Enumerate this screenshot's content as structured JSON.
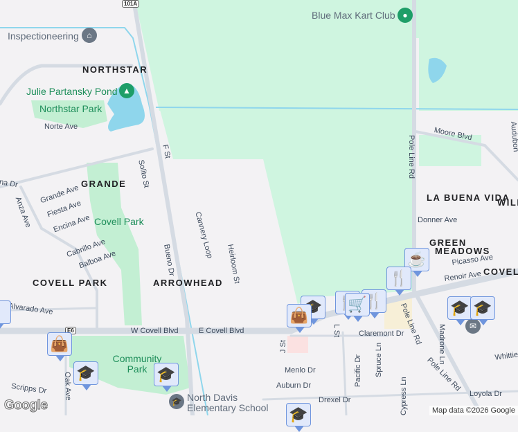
{
  "map": {
    "colors": {
      "field": "#cff5e0",
      "park": "#c3efd3",
      "water": "#8fd6ec",
      "road": "#d5dbe3",
      "bg": "#f3f2f4",
      "marker_bg": "#e1e9fb",
      "marker_border": "#6f95dd",
      "marker_icon": "#0d4a6b"
    },
    "neighborhoods": [
      "NORTHSTAR",
      "GRANDE",
      "COVELL PARK",
      "ARROWHEAD",
      "LA BUENA VIDA",
      "GREEN",
      "MEADOWS",
      "COVELL",
      "WILD"
    ],
    "parks": [
      "Julie Partansky Pond",
      "Northstar Park",
      "Covell Park",
      "Community Park"
    ],
    "pois": [
      "Inspectioneering",
      "Blue Max Kart Club",
      "North Davis Elementary School"
    ],
    "streets": [
      "Norte Ave",
      "Grande Ave",
      "Fiesta Ave",
      "Encina Ave",
      "Cabrillo Ave",
      "Balboa Ave",
      "Anza Ave",
      "Solito St",
      "F St",
      "Cannery Loop",
      "Heirloom St",
      "Bueno Dr",
      "Alvarado Ave",
      "W Covell Blvd",
      "E Covell Blvd",
      "Oak Ave",
      "Scripps Dr",
      "J St",
      "L St",
      "Claremont Dr",
      "Menlo Dr",
      "Auburn Dr",
      "Drexel Dr",
      "Pacific Dr",
      "Spruce Ln",
      "Cypress Ln",
      "Pole Line Rd",
      "Pole Line Rd",
      "Madrone Ln",
      "Loyola Dr",
      "Whittier",
      "Moore Blvd",
      "Donner Ave",
      "Picasso Ave",
      "Renoir Ave",
      "na Dr",
      "Audubon"
    ],
    "shields": [
      "101A",
      "E6"
    ],
    "attribution": "Map data ©2026 Google",
    "logo": "Google"
  }
}
